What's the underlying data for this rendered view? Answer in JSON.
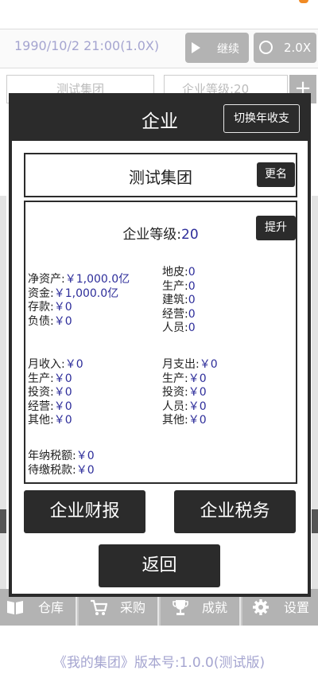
{
  "status_bar": {
    "datetime": "1990/10/2 21:00(1.0X)",
    "continue_label": "继续",
    "speed_label": "2.0X"
  },
  "background": {
    "company_name_field": "测试集团",
    "company_level_field": "企业等级:20",
    "plus_symbol": "+"
  },
  "dialog": {
    "title": "企业",
    "toggle_button": "切换年收支",
    "company_name": "测试集团",
    "rename_button": "更名",
    "level_label": "企业等级:",
    "level_value": "20",
    "upgrade_button": "提升",
    "assets": [
      {
        "label": "净资产:",
        "value": "￥1,000.0亿"
      },
      {
        "label": "资金:",
        "value": "￥1,000.0亿"
      },
      {
        "label": "存款:",
        "value": "￥0"
      },
      {
        "label": "负债:",
        "value": "￥0"
      }
    ],
    "holdings": [
      {
        "label": "地皮:",
        "value": "0"
      },
      {
        "label": "生产:",
        "value": "0"
      },
      {
        "label": "建筑:",
        "value": "0"
      },
      {
        "label": "经营:",
        "value": "0"
      },
      {
        "label": "人员:",
        "value": "0"
      }
    ],
    "monthly_income": [
      {
        "label": "月收入:",
        "value": "￥0"
      },
      {
        "label": "生产:",
        "value": "￥0"
      },
      {
        "label": "投资:",
        "value": "￥0"
      },
      {
        "label": "经营:",
        "value": "￥0"
      },
      {
        "label": "其他:",
        "value": "￥0"
      }
    ],
    "monthly_expense": [
      {
        "label": "月支出:",
        "value": "￥0"
      },
      {
        "label": "生产:",
        "value": "￥0"
      },
      {
        "label": "投资:",
        "value": "￥0"
      },
      {
        "label": "人员:",
        "value": "￥0"
      },
      {
        "label": "其他:",
        "value": "￥0"
      }
    ],
    "taxes": [
      {
        "label": "年纳税额:",
        "value": "￥0"
      },
      {
        "label": "待缴税款:",
        "value": "￥0"
      }
    ],
    "report_button": "企业财报",
    "tax_button": "企业税务",
    "back_button": "返回"
  },
  "bottom_nav": [
    {
      "label": "仓库",
      "icon": "book-icon"
    },
    {
      "label": "采购",
      "icon": "cart-icon"
    },
    {
      "label": "成就",
      "icon": "trophy-icon"
    },
    {
      "label": "设置",
      "icon": "gear-icon"
    }
  ],
  "footer": "《我的集团》版本号:1.0.0(测试版)"
}
